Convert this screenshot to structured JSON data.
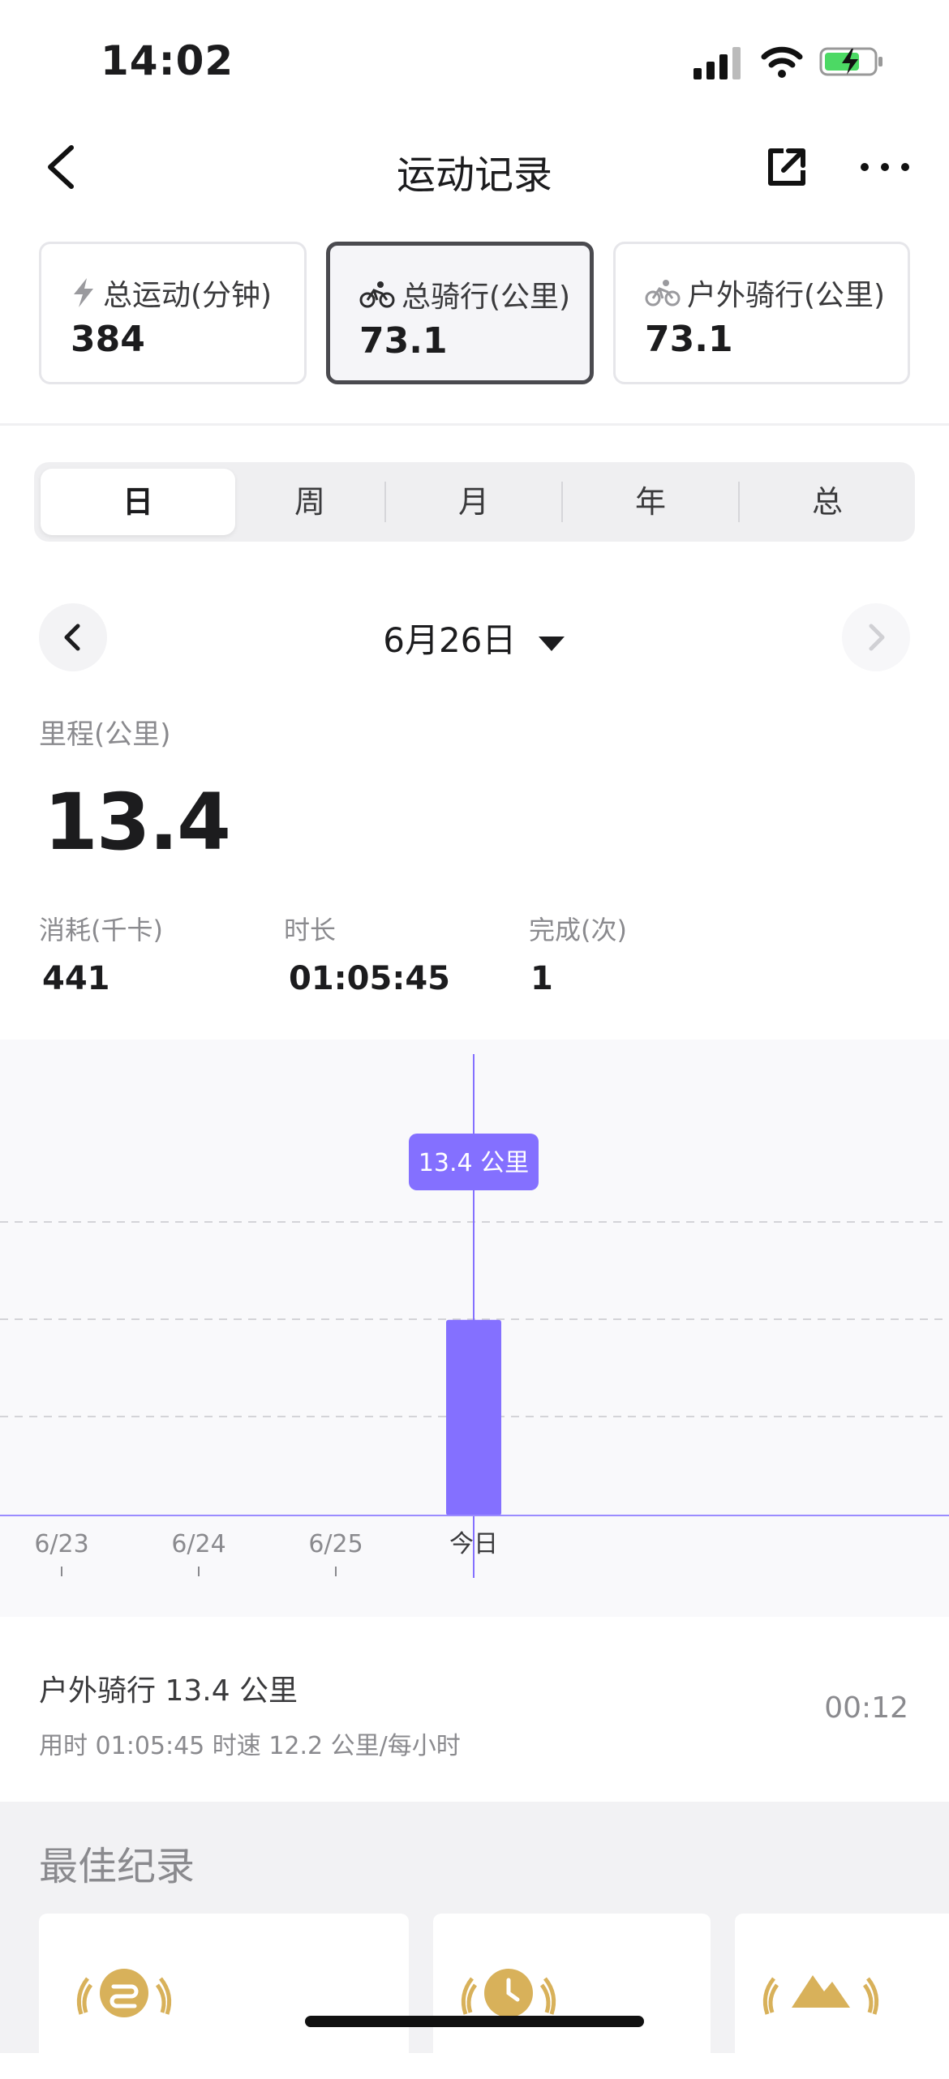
{
  "status_bar": {
    "time": "14:02"
  },
  "nav": {
    "title": "运动记录"
  },
  "summary_cards": [
    {
      "label": "总运动(分钟)",
      "value": "384",
      "icon": "bolt-icon"
    },
    {
      "label": "总骑行(公里)",
      "value": "73.1",
      "icon": "bike-icon",
      "selected": true
    },
    {
      "label": "户外骑行(公里)",
      "value": "73.1",
      "icon": "bike-icon"
    }
  ],
  "period_tabs": {
    "items": [
      "日",
      "周",
      "月",
      "年",
      "总"
    ],
    "selected": "日"
  },
  "date_selector": {
    "label": "6月26日"
  },
  "metrics": {
    "distance_label": "里程(公里)",
    "distance_value": "13.4",
    "calories_label": "消耗(千卡)",
    "calories_value": "441",
    "duration_label": "时长",
    "duration_value": "01:05:45",
    "completed_label": "完成(次)",
    "completed_value": "1"
  },
  "chart_data": {
    "type": "bar",
    "categories": [
      "6/23",
      "6/24",
      "6/25",
      "今日"
    ],
    "values": [
      0,
      0,
      0,
      13.4
    ],
    "tooltip": "13.4 公里",
    "bar_color": "#8470ff",
    "grid": true
  },
  "record": {
    "title": "户外骑行  13.4 公里",
    "subtitle": "用时 01:05:45    时速 12.2 公里/每小时",
    "time": "00:12"
  },
  "best_records": {
    "title": "最佳纪录"
  },
  "colors": {
    "accent": "#8470ff",
    "gold": "#d8b15a"
  }
}
